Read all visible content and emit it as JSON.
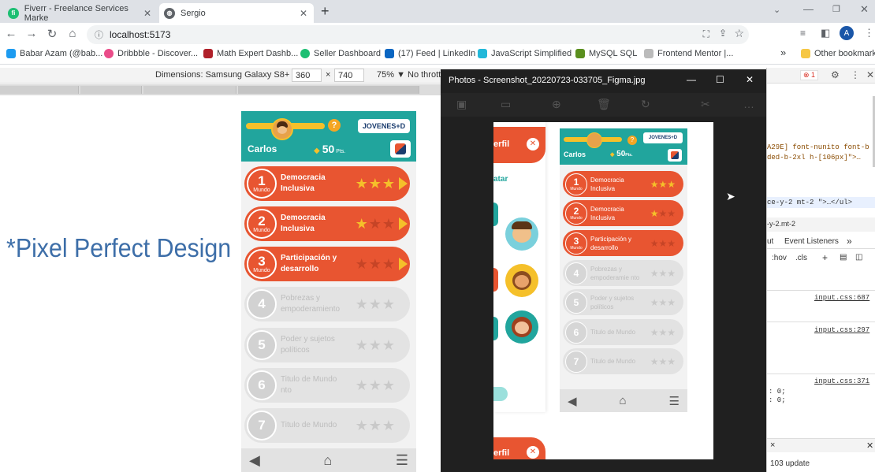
{
  "browser": {
    "tabs": [
      {
        "label": "Fiverr - Freelance Services Marke",
        "active": false
      },
      {
        "label": "Sergio",
        "active": true
      }
    ],
    "new_tab": "+",
    "url": "localhost:5173",
    "bookmarks": [
      "Babar Azam (@bab...",
      "Dribbble - Discover...",
      "Math Expert Dashb...",
      "Seller Dashboard",
      "(17) Feed | LinkedIn",
      "JavaScript Simplified",
      "MySQL SQL",
      "Frontend Mentor |..."
    ],
    "more_bookmarks": "»",
    "other_bookmarks": "Other bookmarks",
    "profile_initial": "A"
  },
  "device_toolbar": {
    "dimensions_label": "Dimensions: Samsung Galaxy S8+ ▼",
    "width": "360",
    "times": "×",
    "height": "740",
    "zoom": "75% ▼",
    "throttle": "No thrott"
  },
  "overlay_text": "*Pixel Perfect Design",
  "app": {
    "brand": "JOVENES+D",
    "username": "Carlos",
    "points": "50",
    "points_unit": "Pts.",
    "help": "?",
    "mundo_label": "Mundo",
    "worlds": [
      {
        "number": "1",
        "title": "Democracia Inclusiva",
        "unlocked": true,
        "stars": 3
      },
      {
        "number": "2",
        "title": "Democracia Inclusiva",
        "unlocked": true,
        "stars": 1
      },
      {
        "number": "3",
        "title": "Participación y desarrollo",
        "unlocked": true,
        "stars": 0
      },
      {
        "number": "4",
        "title": "Pobrezas y empoderamiento",
        "unlocked": false,
        "stars": 0
      },
      {
        "number": "5",
        "title": "Poder y sujetos políticos",
        "unlocked": false,
        "stars": 0
      },
      {
        "number": "6",
        "title": "Titulo de Mundo nto",
        "unlocked": false,
        "stars": 0
      },
      {
        "number": "7",
        "title": "Titulo de Mundo",
        "unlocked": false,
        "stars": 0
      }
    ]
  },
  "photos": {
    "title": "Photos - Screenshot_20220723-033705_Figma.jpg",
    "left_panel": {
      "perfil": "erfil",
      "avatar_label": "atar"
    },
    "mini_worlds": [
      {
        "number": "1",
        "title": "Democracia Inclusiva",
        "unlocked": true,
        "stars": 3
      },
      {
        "number": "2",
        "title": "Democracia Inclusiva",
        "unlocked": true,
        "stars": 1
      },
      {
        "number": "3",
        "title": "Participación y desarrollo",
        "unlocked": true,
        "stars": 0
      },
      {
        "number": "4",
        "title": "Pobrezas y empoderamie nto",
        "unlocked": false,
        "stars": 0
      },
      {
        "number": "5",
        "title": "Poder y sujetos políticos",
        "unlocked": false,
        "stars": 0
      },
      {
        "number": "6",
        "title": "Titulo de Mundo",
        "unlocked": false,
        "stars": 0
      },
      {
        "number": "7",
        "title": "Titulo de Mundo",
        "unlocked": false,
        "stars": 0
      }
    ]
  },
  "devtools": {
    "lines": [
      "A29E] font-nunito font-b",
      "ded-b-2xl h-[106px]\">…",
      "ce-y-2 mt-2 \">…</ul>",
      "-y-2.mt-2"
    ],
    "tabs": [
      "ut",
      "Event Listeners",
      "»"
    ],
    "filter": [
      ":hov",
      ".cls",
      "+"
    ],
    "links": [
      "input.css:687",
      "input.css:297",
      "input.css:371"
    ],
    "values": [
      ": 0;",
      ": 0;"
    ],
    "close": "×",
    "update": "103 update",
    "errors": "1"
  }
}
